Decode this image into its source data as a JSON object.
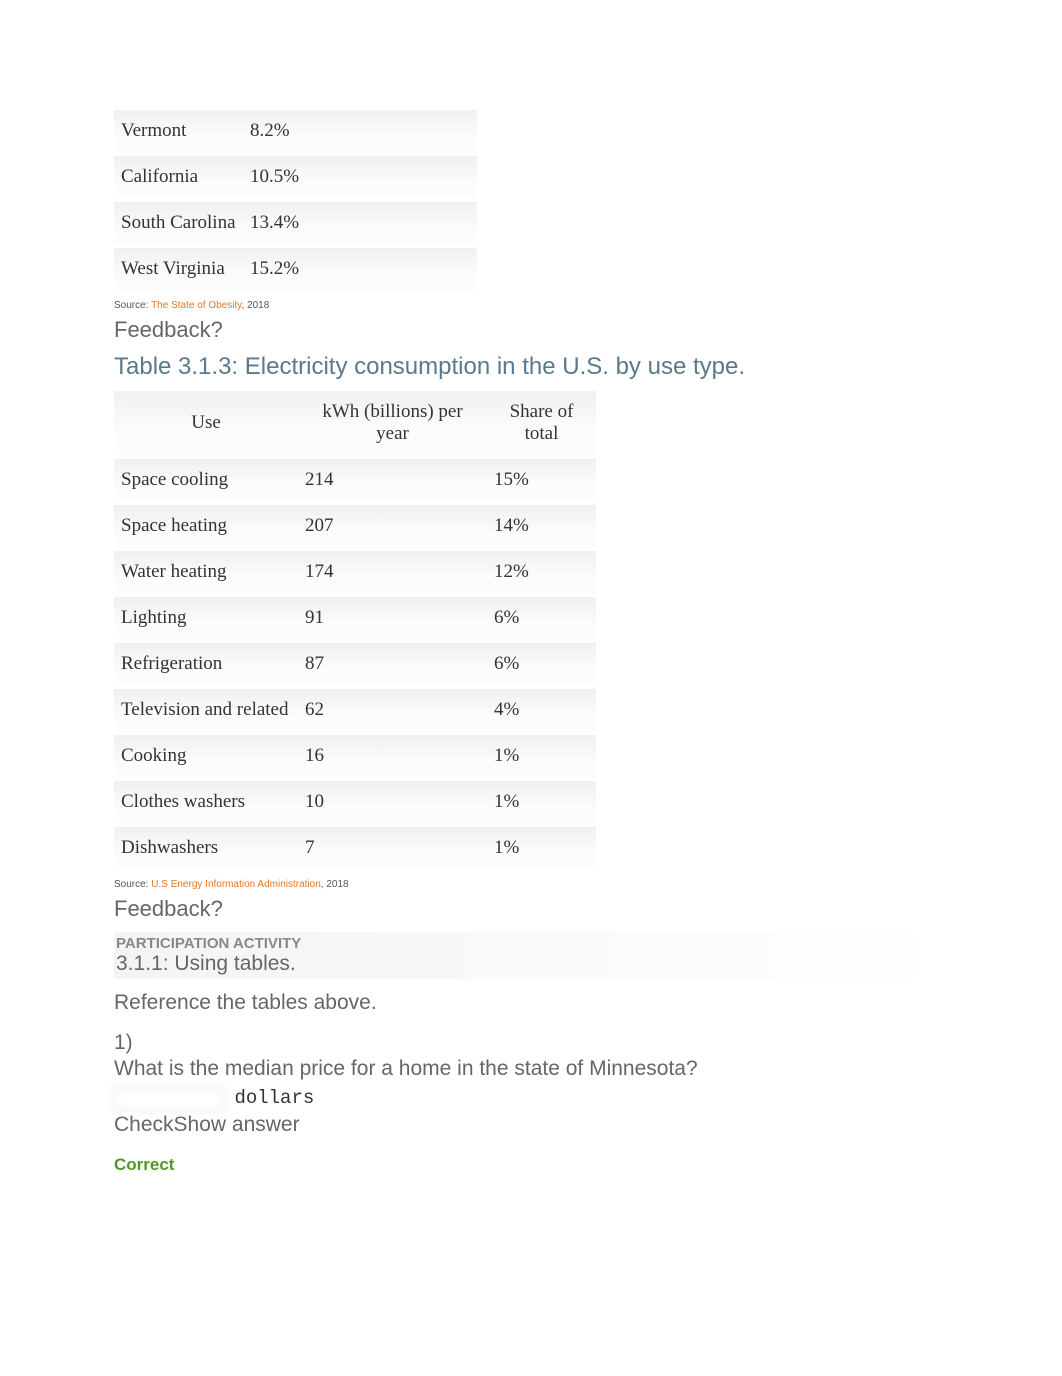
{
  "table1": {
    "rows": [
      {
        "state": "Vermont",
        "pct": "8.2%"
      },
      {
        "state": "California",
        "pct": "10.5%"
      },
      {
        "state": "South Carolina",
        "pct": "13.4%"
      },
      {
        "state": "West Virginia",
        "pct": "15.2%"
      }
    ],
    "source_prefix": "Source: ",
    "source_link": "The State of Obesity",
    "source_suffix": ", 2018"
  },
  "feedback": "Feedback?",
  "table2_title": "Table 3.1.3: Electricity consumption in the U.S. by use type.",
  "table2": {
    "headers": [
      "Use",
      "kWh (billions) per year",
      "Share of total"
    ],
    "rows": [
      {
        "use": "Space cooling",
        "kwh": "214",
        "share": "15%"
      },
      {
        "use": "Space heating",
        "kwh": "207",
        "share": "14%"
      },
      {
        "use": "Water heating",
        "kwh": "174",
        "share": "12%"
      },
      {
        "use": "Lighting",
        "kwh": "91",
        "share": "6%"
      },
      {
        "use": "Refrigeration",
        "kwh": "87",
        "share": "6%"
      },
      {
        "use": "Television and related",
        "kwh": "62",
        "share": "4%"
      },
      {
        "use": "Cooking",
        "kwh": "16",
        "share": "1%"
      },
      {
        "use": "Clothes washers",
        "kwh": "10",
        "share": "1%"
      },
      {
        "use": "Dishwashers",
        "kwh": "7",
        "share": "1%"
      }
    ],
    "source_prefix": "Source: ",
    "source_link": "U.S Energy Information Administration",
    "source_suffix": ", 2018"
  },
  "activity": {
    "label": "PARTICIPATION ACTIVITY",
    "title": "3.1.1: Using tables.",
    "instruction": "Reference the tables above.",
    "q1_num": "1)",
    "q1_text": "What is the median price for a home in the state of Minnesota?",
    "unit": "dollars",
    "check": "Check",
    "show": "Show answer",
    "correct": "Correct"
  }
}
